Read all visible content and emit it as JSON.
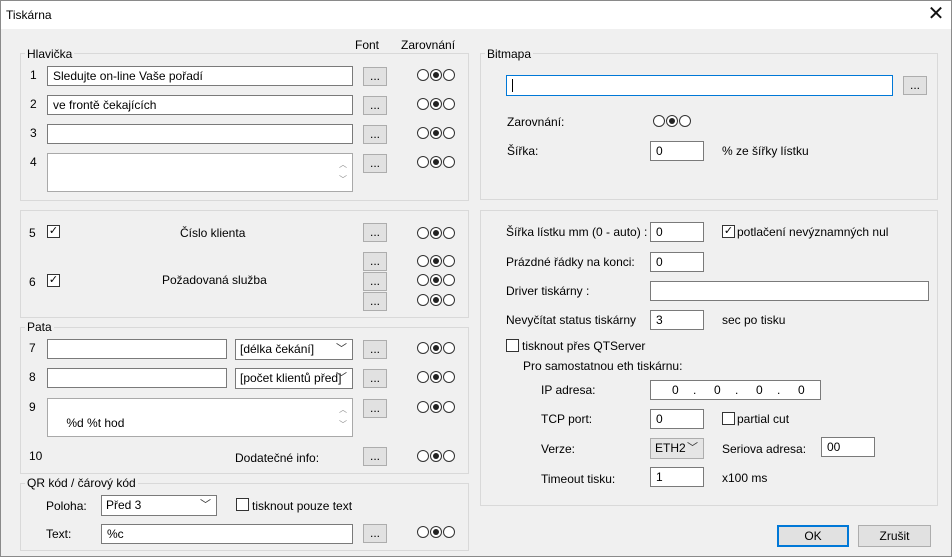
{
  "window": {
    "title": "Tiskárna"
  },
  "columns": {
    "font": "Font",
    "align": "Zarovnání"
  },
  "header": {
    "label": "Hlavička",
    "rows": [
      {
        "num": "1",
        "value": "Sledujte on-line Vaše pořadí",
        "align": 1
      },
      {
        "num": "2",
        "value": "ve frontě čekajících",
        "align": 1
      },
      {
        "num": "3",
        "value": "",
        "align": 1
      },
      {
        "num": "4",
        "value": "",
        "align": 1
      }
    ]
  },
  "body": {
    "rows": [
      {
        "num": "5",
        "checked": true,
        "label": "Číslo klienta",
        "align": 1
      },
      {
        "num": "6",
        "checked": true,
        "label": "Požadovaná služba",
        "aligns": [
          1,
          1,
          1
        ]
      }
    ]
  },
  "footer": {
    "label": "Pata",
    "rows": [
      {
        "num": "7",
        "value": "",
        "select": "[délka čekání]",
        "align": 1
      },
      {
        "num": "8",
        "value": "",
        "select": "[počet klientů před]",
        "align": 1
      },
      {
        "num": "9",
        "value": "%d %t hod",
        "align": 1
      },
      {
        "num": "10",
        "label": "Dodatečné info:",
        "align": 1
      }
    ]
  },
  "qr": {
    "label": "QR kód / čárový kód",
    "position_label": "Poloha:",
    "position_value": "Před 3",
    "text_only_label": "tisknout pouze text",
    "text_only_checked": false,
    "text_label": "Text:",
    "text_value": "%c",
    "align": 1
  },
  "bitmap": {
    "label": "Bitmapa",
    "path": "",
    "align_label": "Zarovnání:",
    "align": 1,
    "width_label": "Šířka:",
    "width_value": "0",
    "width_unit": "% ze šířky lístku"
  },
  "settings": {
    "ticket_width_label": "Šířka lístku mm (0 - auto) :",
    "ticket_width": "0",
    "suppress_label": "potlačení nevýznamných nul",
    "suppress_checked": true,
    "empty_lines_label": "Prázdné řádky na konci:",
    "empty_lines": "0",
    "driver_label": "Driver tiskárny :",
    "driver": "",
    "no_status_label": "Nevyčítat status tiskárny",
    "no_status": "3",
    "no_status_unit": "sec po tisku",
    "qtserver_label": "tisknout přes QTServer",
    "qtserver_checked": false,
    "eth_heading": "Pro samostatnou eth tiskárnu:",
    "ip_label": "IP adresa:",
    "ip": [
      "0",
      "0",
      "0",
      "0"
    ],
    "tcp_label": "TCP port:",
    "tcp": "0",
    "partial_cut_label": "partial cut",
    "partial_cut_checked": false,
    "version_label": "Verze:",
    "version": "ETH2",
    "serial_label": "Seriova adresa:",
    "serial": "00",
    "timeout_label": "Timeout tisku:",
    "timeout": "1",
    "timeout_unit": "x100 ms"
  },
  "buttons": {
    "dots": "...",
    "ok": "OK",
    "cancel": "Zrušit"
  }
}
